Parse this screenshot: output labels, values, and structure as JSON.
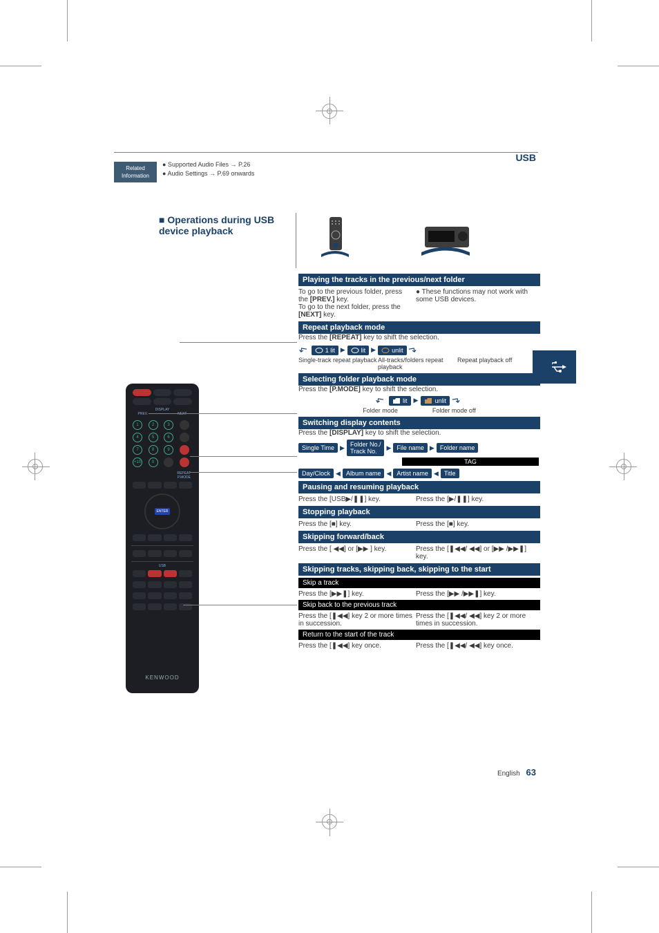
{
  "header": {
    "usb": "USB"
  },
  "related": {
    "box_l1": "Related",
    "box_l2": "Information",
    "b1": "● Supported Audio Files → P.26",
    "b2": "● Audio Settings → P.69 onwards"
  },
  "section_title": "■ Operations during USB device playback",
  "footer": {
    "lang": "English",
    "page": "63"
  },
  "s1": {
    "title": "Playing the tracks in the previous/next folder",
    "l1": "To go to the previous folder, press the ",
    "l1b": "[PREV.]",
    "l1c": " key.",
    "l2": "To go to the next folder, press the ",
    "l2b": "[NEXT]",
    "l2c": " key.",
    "note": "● These functions may not work with some USB devices."
  },
  "s2": {
    "title": "Repeat playback mode",
    "instr_a": "Press the ",
    "instr_b": "[REPEAT]",
    "instr_c": " key to shift the selection.",
    "i1": "1 lit",
    "i2": "lit",
    "i3": "unlit",
    "c1": "Single-track repeat playback",
    "c2": "All-tracks/folders repeat playback",
    "c3": "Repeat playback off"
  },
  "s3": {
    "title": "Selecting folder playback mode",
    "instr_a": "Press the ",
    "instr_b": "[P.MODE]",
    "instr_c": " key to shift the selection.",
    "i1": "lit",
    "i2": "unlit",
    "c1": "Folder mode",
    "c2": "Folder mode off"
  },
  "s4": {
    "title": "Switching display contents",
    "instr_a": "Press the ",
    "instr_b": "[DISPLAY]",
    "instr_c": " key to shift the selection.",
    "d1": "Single Time",
    "d2a": "Folder No./",
    "d2b": "Track No.",
    "d3": "File name",
    "d4": "Folder name",
    "tag": "TAG",
    "d5": "Day/Clock",
    "d6": "Album name",
    "d7": "Artist name",
    "d8": "Title"
  },
  "s5": {
    "title": "Pausing and resuming playback",
    "l": "Press the [USB▶/❚❚] key.",
    "r": "Press the [▶/❚❚] key."
  },
  "s6": {
    "title": "Stopping playback",
    "l": "Press the [■] key.",
    "r": "Press the [■] key."
  },
  "s7": {
    "title": "Skipping forward/back",
    "l": "Press the [ ◀◀] or [▶▶ ] key.",
    "r": "Press the [❚◀◀/ ◀◀] or [▶▶ /▶▶❚] key."
  },
  "s8": {
    "title": "Skipping tracks, skipping back, skipping to the start",
    "sub1": "Skip a track",
    "sub1l": "Press the [▶▶❚] key.",
    "sub1r": "Press the [▶▶ /▶▶❚] key.",
    "sub2": "Skip back to the previous track",
    "sub2l": "Press the [❚◀◀] key 2 or more times in succession.",
    "sub2r": "Press the [❚◀◀/ ◀◀] key 2 or more times in succession.",
    "sub3": "Return to the start of the track",
    "sub3l": "Press the [❚◀◀] key once.",
    "sub3r": "Press the [❚◀◀/ ◀◀] key once."
  },
  "remote_brand": "KENWOOD",
  "remote_labels": {
    "prev": "PREV.",
    "next": "NEXT",
    "display": "DISPLAY",
    "repeat": "REPEAT",
    "pmode": "P.MODE",
    "usb": "USB"
  }
}
